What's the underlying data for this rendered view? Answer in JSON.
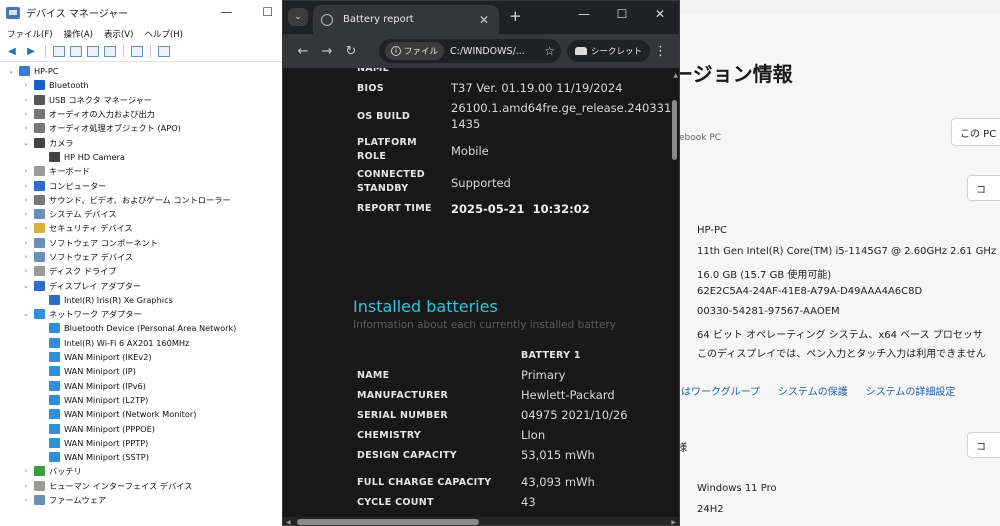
{
  "device_manager": {
    "title": "デバイス マネージャー",
    "window_controls": [
      "—",
      "☐"
    ],
    "menu": [
      "ファイル(F)",
      "操作(A)",
      "表示(V)",
      "ヘルプ(H)"
    ],
    "tree": [
      {
        "label": "HP-PC",
        "level": 0,
        "expanded": true,
        "icon": "computer-icon"
      },
      {
        "label": "Bluetooth",
        "level": 1,
        "expanded": false,
        "icon": "bluetooth-icon"
      },
      {
        "label": "USB コネクタ マネージャー",
        "level": 1,
        "expanded": false,
        "icon": "usb-icon"
      },
      {
        "label": "オーディオの入力および出力",
        "level": 1,
        "expanded": false,
        "icon": "speaker-icon"
      },
      {
        "label": "オーディオ処理オブジェクト (APO)",
        "level": 1,
        "expanded": false,
        "icon": "speaker-icon"
      },
      {
        "label": "カメラ",
        "level": 1,
        "expanded": true,
        "icon": "camera-icon"
      },
      {
        "label": "HP HD Camera",
        "level": 2,
        "icon": "camera-icon"
      },
      {
        "label": "キーボード",
        "level": 1,
        "expanded": false,
        "icon": "keyboard-icon"
      },
      {
        "label": "コンピューター",
        "level": 1,
        "expanded": false,
        "icon": "monitor-icon"
      },
      {
        "label": "サウンド、ビデオ、およびゲーム コントローラー",
        "level": 1,
        "expanded": false,
        "icon": "sound-icon"
      },
      {
        "label": "システム デバイス",
        "level": 1,
        "expanded": false,
        "icon": "system-icon"
      },
      {
        "label": "セキュリティ デバイス",
        "level": 1,
        "expanded": false,
        "icon": "security-icon"
      },
      {
        "label": "ソフトウェア コンポーネント",
        "level": 1,
        "expanded": false,
        "icon": "component-icon"
      },
      {
        "label": "ソフトウェア デバイス",
        "level": 1,
        "expanded": false,
        "icon": "component-icon"
      },
      {
        "label": "ディスク ドライブ",
        "level": 1,
        "expanded": false,
        "icon": "disk-icon"
      },
      {
        "label": "ディスプレイ アダプター",
        "level": 1,
        "expanded": true,
        "icon": "display-icon"
      },
      {
        "label": "Intel(R) Iris(R) Xe Graphics",
        "level": 2,
        "icon": "display-icon"
      },
      {
        "label": "ネットワーク アダプター",
        "level": 1,
        "expanded": true,
        "icon": "network-icon"
      },
      {
        "label": "Bluetooth Device (Personal Area Network)",
        "level": 2,
        "icon": "network-icon"
      },
      {
        "label": "Intel(R) Wi-Fi 6 AX201 160MHz",
        "level": 2,
        "icon": "network-icon"
      },
      {
        "label": "WAN Miniport (IKEv2)",
        "level": 2,
        "icon": "network-icon"
      },
      {
        "label": "WAN Miniport (IP)",
        "level": 2,
        "icon": "network-icon"
      },
      {
        "label": "WAN Miniport (IPv6)",
        "level": 2,
        "icon": "network-icon"
      },
      {
        "label": "WAN Miniport (L2TP)",
        "level": 2,
        "icon": "network-icon"
      },
      {
        "label": "WAN Miniport (Network Monitor)",
        "level": 2,
        "icon": "network-icon"
      },
      {
        "label": "WAN Miniport (PPPOE)",
        "level": 2,
        "icon": "network-icon"
      },
      {
        "label": "WAN Miniport (PPTP)",
        "level": 2,
        "icon": "network-icon"
      },
      {
        "label": "WAN Miniport (SSTP)",
        "level": 2,
        "icon": "network-icon"
      },
      {
        "label": "バッテリ",
        "level": 1,
        "expanded": false,
        "icon": "battery-icon"
      },
      {
        "label": "ヒューマン インターフェイス デバイス",
        "level": 1,
        "expanded": false,
        "icon": "hid-icon"
      },
      {
        "label": "ファームウェア",
        "level": 1,
        "expanded": false,
        "icon": "firmware-icon"
      }
    ]
  },
  "browser": {
    "tab_title": "Battery report",
    "window_controls": [
      "—",
      "☐",
      "✕"
    ],
    "address_chip": "ファイル",
    "url": "C:/WINDOWS/...",
    "incognito_label": "シークレット",
    "report": {
      "partial_top_label": "NAME",
      "system_rows": [
        {
          "label": "BIOS",
          "value": "T37 Ver. 01.19.00 11/19/2024"
        },
        {
          "label": "OS BUILD",
          "value": "26100.1.amd64fre.ge_release.240331-1435"
        },
        {
          "label": "PLATFORM ROLE",
          "value": "Mobile"
        },
        {
          "label": "CONNECTED STANDBY",
          "value": "Supported"
        },
        {
          "label": "REPORT TIME",
          "value": "2025-05-21  10:32:02"
        }
      ],
      "installed_title": "Installed batteries",
      "installed_subtitle": "Information about each currently installed battery",
      "battery_column": "BATTERY 1",
      "battery_rows": [
        {
          "label": "NAME",
          "value": "Primary"
        },
        {
          "label": "MANUFACTURER",
          "value": "Hewlett-Packard"
        },
        {
          "label": "SERIAL NUMBER",
          "value": "04975 2021/10/26"
        },
        {
          "label": "CHEMISTRY",
          "value": "LIon"
        },
        {
          "label": "DESIGN CAPACITY",
          "value": "53,015 mWh"
        },
        {
          "label": "FULL CHARGE CAPACITY",
          "value": "43,093 mWh"
        },
        {
          "label": "CYCLE COUNT",
          "value": "43"
        }
      ]
    }
  },
  "settings": {
    "heading_fragment": "ージョン情報",
    "model_fragment": "ebook PC",
    "rename_button_fragment": "この PC の",
    "copy_button_fragment": "コ",
    "specs": [
      "HP-PC",
      "11th Gen Intel(R) Core(TM) i5-1145G7 @ 2.60GHz   2.61 GHz",
      "16.0 GB (15.7 GB 使用可能)",
      "62E2C5A4-24AF-41E8-A79A-D49AAA4A6C8D",
      "00330-54281-97567-AAOEM",
      "64 ビット オペレーティング システム、x64 ベース プロセッサ",
      "このディスプレイでは、ペン入力とタッチ入力は利用できません"
    ],
    "links": [
      "たはワークグループ",
      "システムの保護",
      "システムの詳細設定"
    ],
    "windows_fragment": "様",
    "copy_button2_fragment": "コ",
    "windows_specs": [
      "Windows 11 Pro",
      "24H2"
    ]
  }
}
